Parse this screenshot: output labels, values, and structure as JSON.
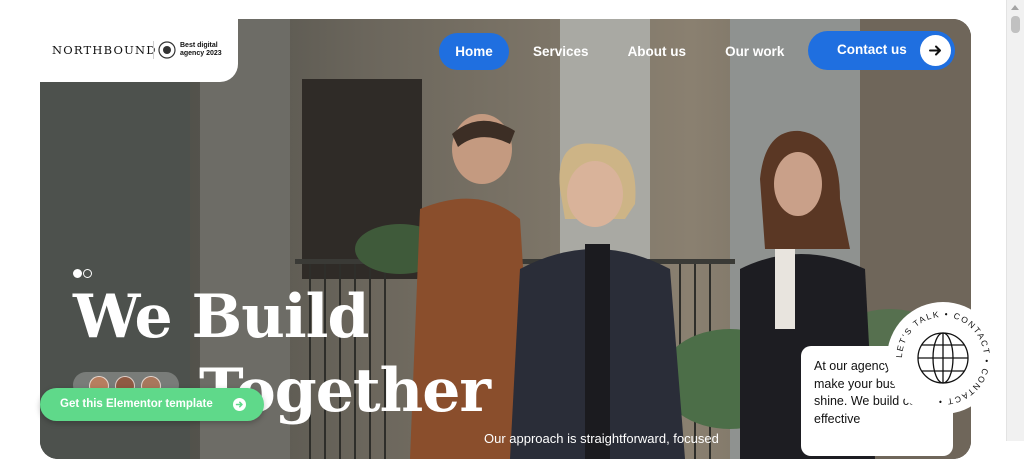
{
  "brand": {
    "name": "NORTHBOUND",
    "award": "Best digital agency 2023"
  },
  "nav": {
    "items": [
      "Home",
      "Services",
      "About us",
      "Our work"
    ],
    "active": "Home",
    "contact_label": "Contact us"
  },
  "hero": {
    "headline_line1": "We Build",
    "headline_line2": "Together",
    "subtext": "Our approach is straightforward, focused",
    "slider_position": 1
  },
  "cta": {
    "elementor_label": "Get this Elementor template"
  },
  "info_card": {
    "text": "At our agency, we make your business shine. We build cool, effective"
  },
  "badge": {
    "ring_text": "LET'S TALK • CONTACT • CONTACT •"
  },
  "colors": {
    "accent": "#1f6fe0",
    "green": "#5fd98a"
  }
}
